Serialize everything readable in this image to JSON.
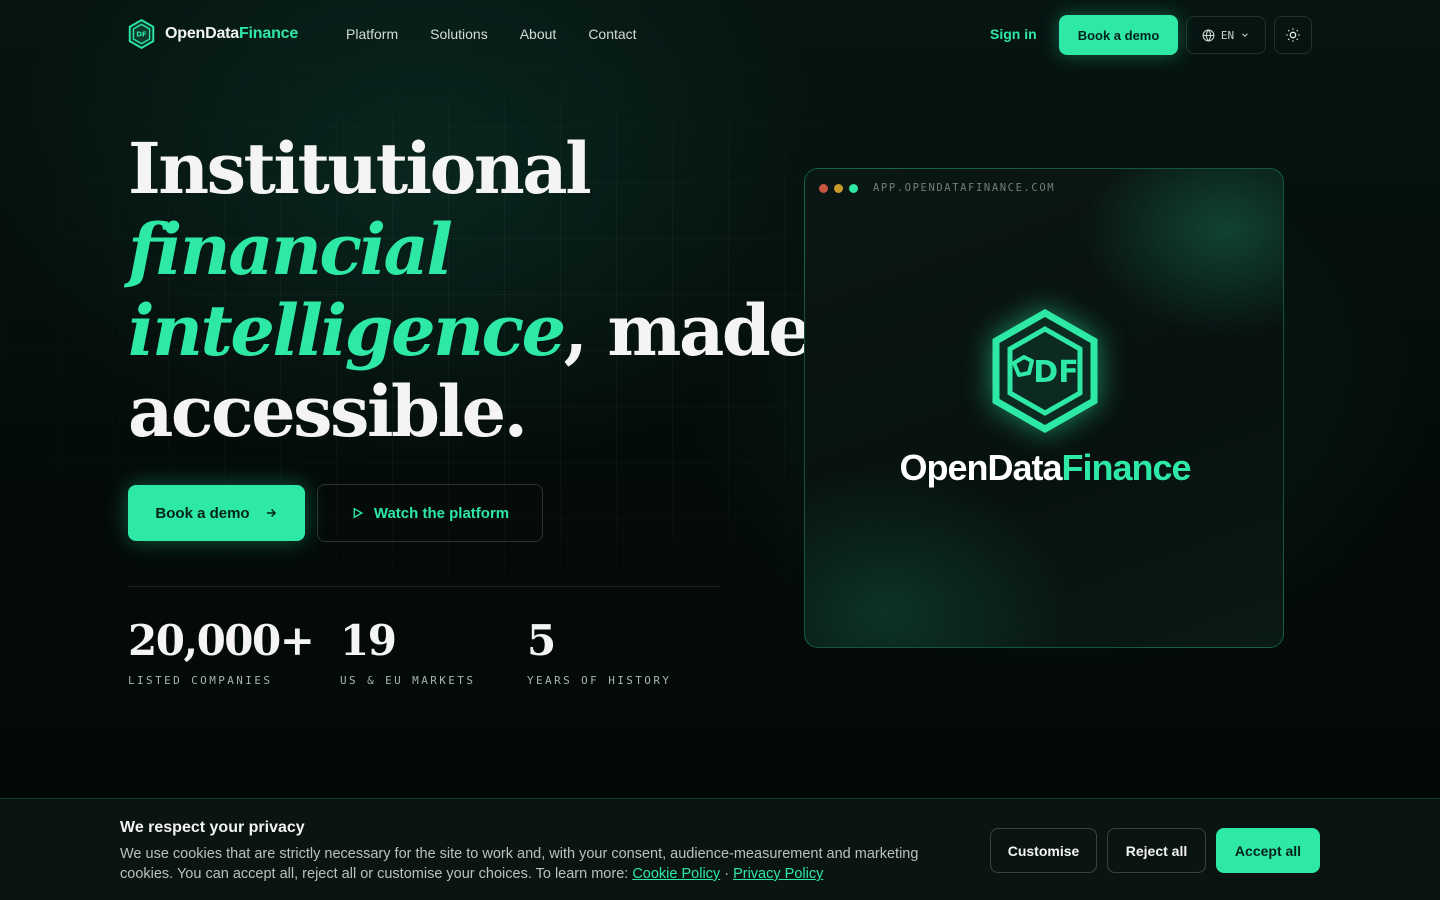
{
  "brand": {
    "name_part1": "OpenData",
    "name_part2": "Finance"
  },
  "nav": {
    "links": [
      "Platform",
      "Solutions",
      "About",
      "Contact"
    ],
    "sign_in": "Sign in",
    "book_demo": "Book a demo",
    "language": "EN"
  },
  "hero": {
    "line1": "Institutional",
    "line2": "financial",
    "line3_accent": "intelligence",
    "line3_rest": ", made",
    "line4": "accessible.",
    "cta_primary": "Book a demo",
    "cta_secondary": "Watch the platform"
  },
  "stats": [
    {
      "value": "20,000+",
      "label": "LISTED COMPANIES"
    },
    {
      "value": "19",
      "label": "US & EU MARKETS"
    },
    {
      "value": "5",
      "label": "YEARS OF HISTORY"
    }
  ],
  "preview": {
    "url": "APP.OPENDATAFINANCE.COM",
    "logo_text": "DF",
    "brand_part1": "OpenData",
    "brand_part2": "Finance",
    "dot_colors": [
      "#c9543f",
      "#c79a2a",
      "#2ee8a5"
    ]
  },
  "cookie": {
    "title": "We respect your privacy",
    "text": "We use cookies that are strictly necessary for the site to work and, with your consent, audience-measurement and marketing cookies. You can accept all, reject all or customise your choices. To learn more:",
    "cookie_policy": "Cookie Policy",
    "separator": "·",
    "privacy_policy": "Privacy Policy",
    "customise": "Customise",
    "reject_all": "Reject all",
    "accept_all": "Accept all"
  },
  "colors": {
    "accent": "#2ee8a5",
    "background": "#040a09"
  },
  "icons": [
    "globe-icon",
    "chevron-down-icon",
    "sun-icon",
    "arrow-right-icon",
    "play-icon",
    "odf-hexagon-logo"
  ]
}
